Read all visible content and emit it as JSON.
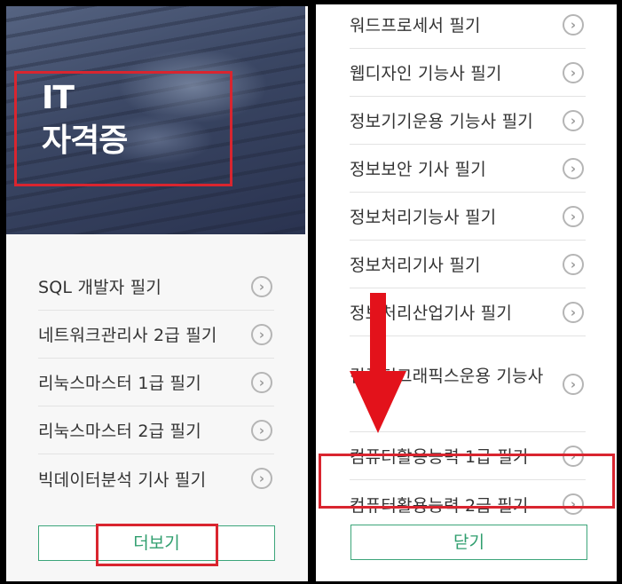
{
  "left": {
    "banner": {
      "line1": "IT",
      "line2": "자격증"
    },
    "items": [
      "SQL 개발자 필기",
      "네트워크관리사 2급 필기",
      "리눅스마스터 1급 필기",
      "리눅스마스터 2급 필기",
      "빅데이터분석 기사 필기"
    ],
    "more_label": "더보기"
  },
  "right": {
    "items": [
      "워드프로세서 필기",
      "웹디자인 기능사 필기",
      "정보기기운용 기능사 필기",
      "정보보안 기사 필기",
      "정보처리기능사 필기",
      "정보처리기사 필기",
      "정보처리산업기사 필기",
      "컴퓨터그래픽스운용 기능사",
      "컴퓨터활용능력 1급 필기",
      "컴퓨터활용능력 2급 필기"
    ],
    "close_label": "닫기"
  },
  "icons": {
    "chevron": "chevron-right-circle-icon",
    "arrow": "down-arrow-annotation"
  },
  "colors": {
    "accent_green": "#3ca57a",
    "highlight_red": "#d9252f"
  }
}
